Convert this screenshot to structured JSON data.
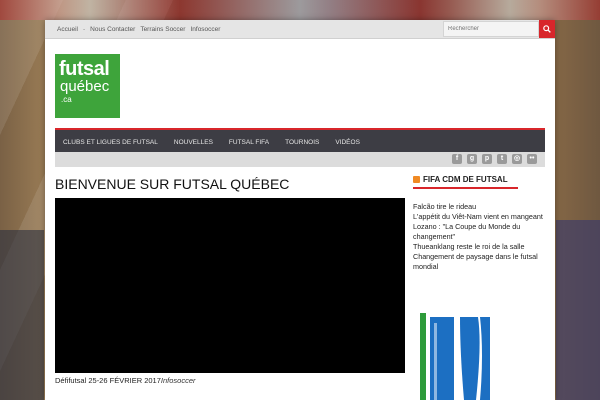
{
  "topnav": {
    "items": [
      "Accueil",
      "Nous Contacter",
      "Terrains Soccer",
      "Infosoccer"
    ]
  },
  "search": {
    "placeholder": "Rechercher"
  },
  "logo": {
    "line1": "futsal",
    "line2": "québec",
    "line3": ".ca"
  },
  "mainnav": {
    "items": [
      "CLUBS ET LIGUES DE FUTSAL",
      "NOUVELLES",
      "FUTSAL FIFA",
      "TOURNOIS",
      "VIDÉOS"
    ]
  },
  "social": {
    "icons": [
      "facebook-icon",
      "google-plus-icon",
      "pinterest-icon",
      "twitter-icon",
      "instagram-icon",
      "flickr-icon"
    ]
  },
  "main": {
    "title": "BIENVENUE SUR FUTSAL QUÉBEC",
    "caption": "Défifutsal 25-26 FÉVRIER 2017",
    "caption_source": "Infosoccer"
  },
  "sidebar": {
    "widget_title": "FIFA CDM DE FUTSAL",
    "news": [
      "Falcão tire le rideau",
      "L'appétit du Viêt-Nam vient en mangeant",
      "Lozano : \"La Coupe du Monde du changement\"",
      "Thueanklang reste le roi de la salle",
      "Changement de paysage dans le futsal mondial"
    ]
  },
  "colors": {
    "accent": "#d8262b",
    "logo_green": "#3ea43b",
    "nav_bg": "#3d3d44"
  }
}
